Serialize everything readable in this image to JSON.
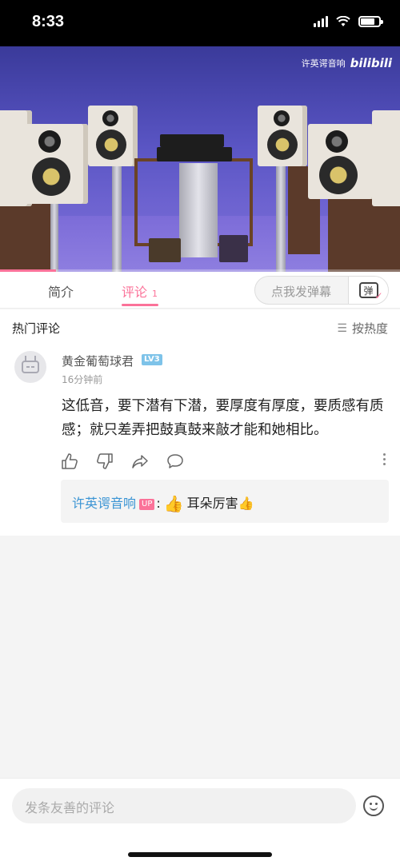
{
  "status_bar": {
    "time": "8:33",
    "battery_level": 0.75
  },
  "video": {
    "watermark_text": "许英谔音响",
    "watermark_logo": "bilibili",
    "progress": 0.14
  },
  "tabs": [
    {
      "label": "简介"
    },
    {
      "label": "评论",
      "count": "1",
      "active": true
    }
  ],
  "danmaku": {
    "placeholder": "点我发弹幕",
    "button_glyph": "弹"
  },
  "comments_section": {
    "title": "热门评论",
    "sort_label": "按热度"
  },
  "comment": {
    "username": "黄金葡萄球君",
    "level": "LV3",
    "time": "16分钟前",
    "text": "这低音，要下潜有下潜，要厚度有厚度，要质感有质感；就只差弄把鼓真鼓来敲才能和她相比。"
  },
  "reply": {
    "username": "许英谔音响",
    "badge": "UP",
    "separator": ":",
    "emoji_big": "👍",
    "text": "耳朵厉害",
    "emoji_small": "👍"
  },
  "bottom": {
    "placeholder": "发条友善的评论"
  },
  "colors": {
    "accent": "#fb7299",
    "link": "#3a94d4",
    "level_badge": "#7ec3e9"
  }
}
